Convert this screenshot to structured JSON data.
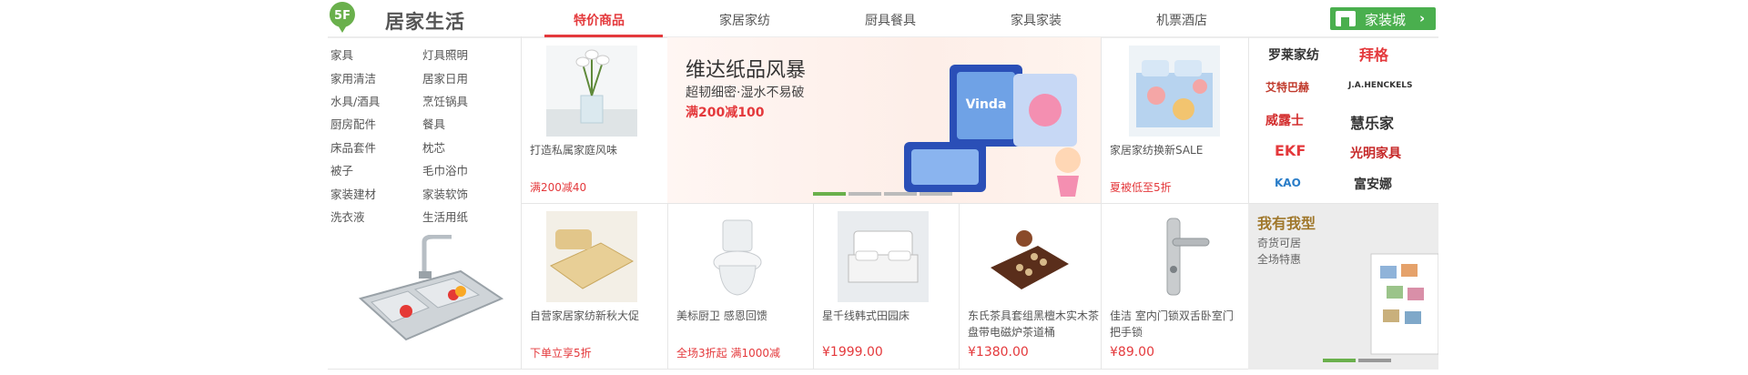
{
  "floor": {
    "badge": "5F",
    "title": "居家生活",
    "tabs": [
      "特价商品",
      "家居家纺",
      "厨具餐具",
      "家具家装",
      "机票酒店"
    ],
    "active_tab": 0,
    "mall_button": "家装城",
    "accent": "#e4393c",
    "green": "#4aaf4e"
  },
  "categories": [
    [
      "家具",
      "灯具照明"
    ],
    [
      "家用清洁",
      "居家日用"
    ],
    [
      "水具/酒具",
      "烹饪锅具"
    ],
    [
      "厨房配件",
      "餐具"
    ],
    [
      "床品套件",
      "枕芯"
    ],
    [
      "被子",
      "毛巾浴巾"
    ],
    [
      "家装建材",
      "家装软饰"
    ],
    [
      "洗衣液",
      "生活用纸"
    ]
  ],
  "banner": {
    "title": "维达纸品风暴",
    "subtitle": "超韧细密·湿水不易破",
    "deal": "满200减100",
    "brand_text": "Vinda"
  },
  "products_top": [
    {
      "title": "打造私属家庭风味",
      "price": "满200减40"
    },
    {
      "title": "家居家纺换新SALE",
      "price": "夏被低至5折"
    }
  ],
  "products_bottom": [
    {
      "title": "自营家居家纺新秋大促",
      "price": "下单立享5折"
    },
    {
      "title": "美标厨卫 感恩回馈",
      "price": "全场3折起 满1000减"
    },
    {
      "title": "星千线韩式田园床",
      "price": "¥1999.00"
    },
    {
      "title": "东氏茶具套组黑檀木实木茶盘带电磁炉茶道桶",
      "price": "¥1380.00"
    },
    {
      "title": "佳洁 室内门锁双舌卧室门把手锁",
      "price": "¥89.00"
    }
  ],
  "brands": [
    {
      "name": "罗莱家纺",
      "color": "#222"
    },
    {
      "name": "拜格",
      "color": "#e4393c"
    },
    {
      "name": "艾特巴赫",
      "color": "#c0392b"
    },
    {
      "name": "J.A.HENCKELS",
      "color": "#333"
    },
    {
      "name": "威露士",
      "color": "#d32f2f"
    },
    {
      "name": "慧乐家",
      "color": "#333"
    },
    {
      "name": "EKF",
      "color": "#e4393c"
    },
    {
      "name": "光明家具",
      "color": "#c62828"
    },
    {
      "name": "KAO",
      "color": "#2a7dc8"
    },
    {
      "name": "富安娜",
      "color": "#333"
    }
  ],
  "promo": {
    "title": "我有我型",
    "lines": [
      "奇货可居",
      "全场特惠"
    ]
  }
}
